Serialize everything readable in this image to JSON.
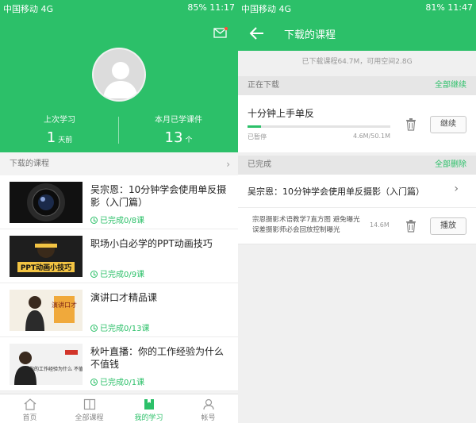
{
  "left": {
    "status": {
      "carrier": "中国移动 4G",
      "battery": "85%",
      "time": "11:17"
    },
    "hero": {
      "last_study_label": "上次学习",
      "last_study_value": "1",
      "last_study_unit": "天前",
      "month_label": "本月已学课件",
      "month_value": "13",
      "month_unit": "个"
    },
    "section_title": "下载的课程",
    "courses": [
      {
        "title": "吴宗恩：10分钟学会使用单反摄影（入门篇）",
        "progress": "已完成0/8课"
      },
      {
        "title": "职场小白必学的PPT动画技巧",
        "progress": "已完成0/9课",
        "thumb_text": "PPT动画小技巧"
      },
      {
        "title": "演讲口才精品课",
        "progress": "已完成0/13课",
        "thumb_text": "演讲口才"
      },
      {
        "title": "秋叶直播：你的工作经验为什么不值钱",
        "progress": "已完成0/1课",
        "thumb_text": "你的工作经验为什么 不值钱"
      }
    ],
    "tabs": [
      {
        "label": "首页",
        "icon": "home-icon"
      },
      {
        "label": "全部课程",
        "icon": "book-icon"
      },
      {
        "label": "我的学习",
        "icon": "study-icon"
      },
      {
        "label": "帐号",
        "icon": "user-icon"
      }
    ]
  },
  "right": {
    "status": {
      "carrier": "中国移动 4G",
      "battery": "81%",
      "time": "11:47"
    },
    "title": "下载的课程",
    "storage": "已下载课程64.7M，可用空间2.8G",
    "downloading": {
      "section": "正在下载",
      "action": "全部继续",
      "item": {
        "title": "十分钟上手单反",
        "status": "已暂停",
        "size": "4.6M/50.1M",
        "progress": 0.092,
        "button": "继续"
      }
    },
    "completed": {
      "section": "已完成",
      "action": "全部删除",
      "course": "吴宗恩：10分钟学会使用单反摄影（入门篇）",
      "item": {
        "title": "宗恩摄影术语教学7直方图 避免曝光误差摄影师必会回放控制曝光",
        "size": "14.6M",
        "button": "播放"
      }
    }
  },
  "colors": {
    "accent": "#2cc069"
  }
}
